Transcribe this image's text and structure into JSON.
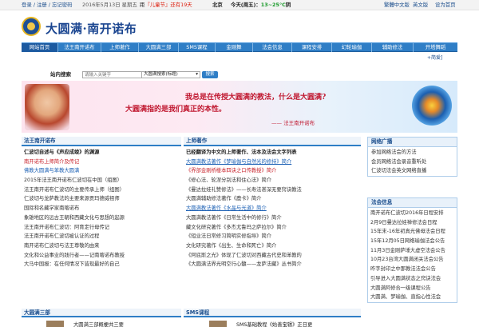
{
  "topbar": {
    "login": "登录 / 注册 / 忘记密码",
    "date": "2016年5月13日 星期五",
    "holiday_prefix": "距",
    "holiday_name": "『儿童节』",
    "holiday_suffix": "还有19天",
    "city": "北京",
    "weather_prefix": "今天(周五)：",
    "weather_temp": "13~25°C",
    "weather_state": "阴",
    "traditional": "繁體中文版",
    "english": "英文版",
    "set_home": "设为首页"
  },
  "logo": {
    "text": "大圆满·南开诺布"
  },
  "nav": {
    "items": [
      "网站首页",
      "法王南开诺布",
      "上师著作",
      "大圆满三部",
      "SMS课程",
      "金刚舞",
      "法会信息",
      "课程安排",
      "幻轮瑜伽",
      "辅助修法",
      "开塔舞蹈"
    ]
  },
  "simplified_link": "+简爱]",
  "search": {
    "label": "站内搜索",
    "placeholder": "请输入关键字",
    "option": "大圆满搜索(标题)",
    "button": "搜索"
  },
  "banner": {
    "line1": "我总是在传授大圆满的教法，什么是大圆满?",
    "line2": "大圆满指的是我们真正的本性。",
    "line3": "—— 法王南开诺布"
  },
  "col1": {
    "title": "法王南开诺布",
    "rows": [
      {
        "text": "仁波切自述与《声应成竣》的渊源",
        "cls": "bold"
      },
      {
        "text": "南开诺布上师简介及传记",
        "cls": "r"
      },
      {
        "text": "佛教大圆满与苯教大圆满",
        "cls": "b"
      },
      {
        "text": "2015年法王南开诺布仁波切在中国（组图）",
        "cls": "k"
      },
      {
        "text": "法王南开诺布仁波切的主要传承上师（组图）",
        "cls": "k"
      },
      {
        "text": "仁波切与龙萨教法的主要来源贡玛德威祖师",
        "cls": "k"
      },
      {
        "text": "国际和名藏学家南喀诺布",
        "cls": "k"
      },
      {
        "text": "象雄地区的远古王朝和西藏文化与思想的起源",
        "cls": "k"
      },
      {
        "text": "法王南开诺布仁波切：阿育定行母传记",
        "cls": "k"
      },
      {
        "text": "法王南开诺布仁波切被认证的过程",
        "cls": "k"
      },
      {
        "text": "南开诺布仁波切与法王尊敬的由来",
        "cls": "k"
      },
      {
        "text": "文化和公益事业的践行者——记南喀诺布教授",
        "cls": "k"
      },
      {
        "text": "大马中国报：在任何情况下皆现最好的自己",
        "cls": "k"
      }
    ]
  },
  "col2": {
    "title": "上师著作",
    "rows": [
      {
        "text": "已经翻译为中文的上师著作、法本及法会文字列表",
        "cls": "bold"
      },
      {
        "text": "大圆满教法著作《梦瑜伽与自然光的修持》简介",
        "cls": "b"
      },
      {
        "text": "《界部金刚桥楼本四诀之口传教授》简介",
        "cls": "r"
      },
      {
        "text": "《修心法、轮涅分别法和住心法》简介",
        "cls": "k"
      },
      {
        "text": "《曼达拉娃礼赞修法》——长寿法甚深无要窍诀教法",
        "cls": "k"
      },
      {
        "text": "大圆满辅助修法著作《鹿卡》简介",
        "cls": "k"
      },
      {
        "text": "大圆满教法著作《水晶与光道》简介",
        "cls": "b"
      },
      {
        "text": "大圆满教法著作《日常生活中的修行》简介",
        "cls": "k"
      },
      {
        "text": "藏文化研究著作《多杰尤鲁玛之萨拉尔》简介",
        "cls": "k"
      },
      {
        "text": "《短业法日常修习简明实修指导》简介",
        "cls": "k"
      },
      {
        "text": "文化研究著作《出生、生命和死亡》简介",
        "cls": "k"
      },
      {
        "text": "《阿底斯之光》体现了仁波切对西藏古代史和苯教的",
        "cls": "k"
      },
      {
        "text": "《大圆满法界光明空行心髓——龙萨法藏》丛书简介",
        "cls": "k"
      }
    ]
  },
  "side1": {
    "title": "网络广播",
    "rows": [
      "参加网络法会的方法",
      "会员网络法会录音重听处",
      "仁波切法会英文网络直播"
    ]
  },
  "side2": {
    "title": "法会信息",
    "rows": [
      "南开诺布仁波切2016年日程安排",
      "2月9日曼达拉娃禅修法会日程",
      "15年末-16年初真光佛母法会日程",
      "15年12月05日网络瑜伽法会公告",
      "11月3日金刚萨埵大虚空法会公告",
      "10月23台湾大圆满闭关法会公告",
      "昨字封印之中那教法法会公告",
      "引导进入大圆满状态之窍诀法会",
      "大圆满阿修合一级课程公告",
      "大圆满、梦瑜伽、直指心性法会"
    ]
  },
  "bottom": {
    "col1_title": "大圆满三部",
    "col1_item": "大圆满三部概梗共三要",
    "col2_title": "SMS课程",
    "col2_item": "SMS基础教程《始善宝辑》正日更"
  },
  "colors": {
    "nav": "#2f7ec6",
    "accent_red": "#c8232c",
    "link_blue": "#1a5fb4"
  }
}
